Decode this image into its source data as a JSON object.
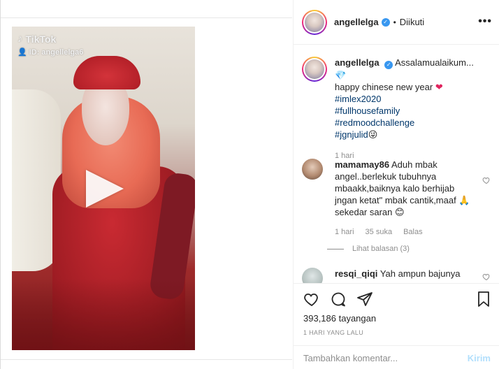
{
  "video": {
    "brand": "TikTok",
    "tiktok_id": "ID: angellelga6",
    "play_icon": "play-icon"
  },
  "header": {
    "username": "angellelga",
    "dot": "•",
    "follow_state": "Diikuti",
    "more_icon": "more-dots"
  },
  "caption": {
    "username": "angellelga",
    "text_line1": "Assalamualaikum...",
    "text_line2": "happy chinese new year",
    "hashtags": [
      "#imlex2020",
      "#fullhousefamily",
      "#redmoodchallenge",
      "#jgnjulid"
    ],
    "time": "1 hari"
  },
  "comments": [
    {
      "username": "mamamay86",
      "text": "Aduh mbak angel..berlekuk tubuhnya mbaakk,baiknya kalo berhijab jngan ketat\" mbak cantik,maaf 🙏 sekedar saran 😊",
      "time": "1 hari",
      "likes": "35 suka",
      "reply": "Balas",
      "view_replies": "Lihat balasan (3)"
    },
    {
      "username": "resqi_qiqi",
      "text": "Yah ampun bajunya"
    }
  ],
  "actions": {
    "views": "393,186 tayangan",
    "time": "1 HARI YANG LALU",
    "comment_placeholder": "Tambahkan komentar...",
    "send_label": "Kirim"
  },
  "colors": {
    "link": "#00376b",
    "verified": "#3897f0",
    "send_disabled": "#b2dffc",
    "muted": "#8e8e8e"
  }
}
